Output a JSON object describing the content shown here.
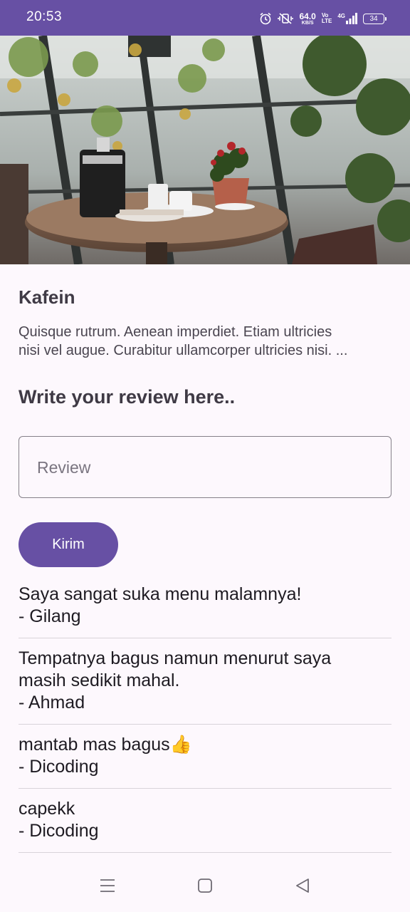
{
  "status_bar": {
    "time": "20:53",
    "net_speed_value": "64.0",
    "net_speed_unit": "KB/S",
    "volte_top": "Vo",
    "volte_bottom": "LTE",
    "signal_label": "4G",
    "battery": "34"
  },
  "hero_image": {
    "icon": "cafe-table-photo"
  },
  "place": {
    "name": "Kafein",
    "description_lines": [
      "Quisque rutrum. Aenean imperdiet. Etiam ultricies",
      "nisi vel augue. Curabitur ullamcorper ultricies nisi. ..."
    ]
  },
  "review_form": {
    "heading": "Write your review here..",
    "placeholder": "Review",
    "value": "",
    "submit_label": "Kirim"
  },
  "reviews": [
    {
      "lines": [
        "Saya sangat suka menu malamnya!"
      ],
      "author": "- Gilang"
    },
    {
      "lines": [
        "Tempatnya bagus namun menurut saya",
        "masih sedikit mahal."
      ],
      "author": "- Ahmad"
    },
    {
      "lines": [
        "mantab mas bagus👍"
      ],
      "author": "- Dicoding"
    },
    {
      "lines": [
        "capekk"
      ],
      "author": "- Dicoding"
    }
  ],
  "nav_bar": {
    "icons": [
      "menu-icon",
      "home-icon",
      "back-icon"
    ]
  },
  "colors": {
    "primary": "#6750a4",
    "background": "#fdf8fd",
    "text": "#3f3a45"
  }
}
